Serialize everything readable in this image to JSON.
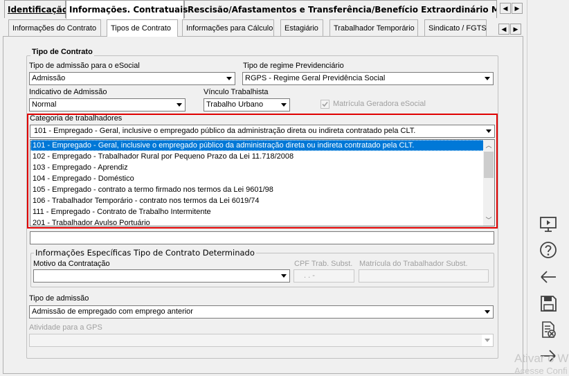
{
  "top_tabs": [
    "Identificação",
    "Informações. Contratuais",
    "Rescisão/Afastamentos e Transferência/Benefício Extraordinário Mensal"
  ],
  "sub_tabs": [
    "Informações do Contrato",
    "Tipos de Contrato",
    "Informações para Cálculo",
    "Estagiário",
    "Trabalhador Temporário",
    "Sindicato / FGTS"
  ],
  "group_tipo_contrato": "Tipo de Contrato",
  "tipo_admissao_esocial": {
    "label": "Tipo de admissão para o eSocial",
    "value": "Admissão"
  },
  "tipo_regime": {
    "label": "Tipo de regime Previdenciário",
    "value": "RGPS - Regime Geral Previdência Social"
  },
  "indicativo": {
    "label": "Indicativo de Admissão",
    "value": "Normal"
  },
  "vinculo": {
    "label": "Vínculo Trabalhista",
    "value": "Trabalho Urbano"
  },
  "matricula_geradora": {
    "label": "Matrícula Geradora eSocial",
    "checked": true
  },
  "categoria": {
    "label": "Categoria de trabalhadores",
    "value": "101 - Empregado - Geral, inclusive o empregado público da administração direta ou indireta contratado pela CLT.",
    "options": [
      "101 - Empregado - Geral, inclusive o empregado público da administração direta ou indireta contratado pela CLT.",
      "102 - Empregado - Trabalhador Rural por Pequeno Prazo da Lei 11.718/2008",
      "103 - Empregado - Aprendiz",
      "104 - Empregado - Doméstico",
      "105 - Empregado - contrato a termo firmado nos termos da Lei 9601/98",
      "106 - Trabalhador Temporário - contrato nos termos da Lei 6019/74",
      "111 - Empregado - Contrato de Trabalho Intermitente",
      "201 - Trabalhador Avulso Portuário"
    ]
  },
  "group_determinado": "Informações Específicas Tipo de Contrato Determinado",
  "motivo": {
    "label": "Motivo da Contratação",
    "value": ""
  },
  "cpf_subst": {
    "label": "CPF Trab. Subst.",
    "value": ". . -"
  },
  "matricula_subst": {
    "label": "Matrícula do Trabalhador Subst.",
    "value": ""
  },
  "tipo_admissao": {
    "label": "Tipo de admissão",
    "value": "Admissão de empregado com emprego anterior"
  },
  "atividade_gps": {
    "label": "Atividade para a GPS",
    "value": ""
  },
  "watermark": [
    "Ativar o W",
    "Acesse Confi"
  ]
}
